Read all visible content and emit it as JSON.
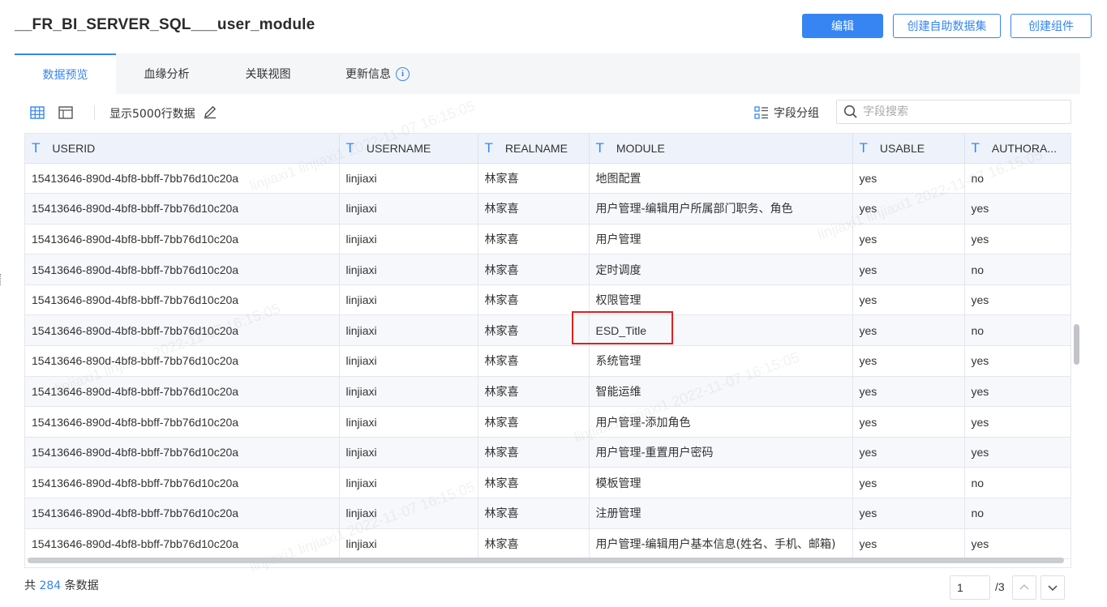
{
  "header": {
    "title": "__FR_BI_SERVER_SQL___user_module",
    "edit_label": "编辑",
    "create_dataset_label": "创建自助数据集",
    "create_component_label": "创建组件"
  },
  "tabs": [
    {
      "label": "数据预览",
      "active": true
    },
    {
      "label": "血缘分析",
      "active": false
    },
    {
      "label": "关联视图",
      "active": false
    },
    {
      "label": "更新信息",
      "active": false
    }
  ],
  "toolbar": {
    "rows_label": "显示5000行数据",
    "group_label": "字段分组",
    "search_placeholder": "字段搜索"
  },
  "table": {
    "type_icon": "T",
    "columns": [
      "USERID",
      "USERNAME",
      "REALNAME",
      "MODULE",
      "USABLE",
      "AUTHORA..."
    ],
    "rows": [
      [
        "15413646-890d-4bf8-bbff-7bb76d10c20a",
        "linjiaxi",
        "林家喜",
        "地图配置",
        "yes",
        "no"
      ],
      [
        "15413646-890d-4bf8-bbff-7bb76d10c20a",
        "linjiaxi",
        "林家喜",
        "用户管理-编辑用户所属部门职务、角色",
        "yes",
        "yes"
      ],
      [
        "15413646-890d-4bf8-bbff-7bb76d10c20a",
        "linjiaxi",
        "林家喜",
        "用户管理",
        "yes",
        "yes"
      ],
      [
        "15413646-890d-4bf8-bbff-7bb76d10c20a",
        "linjiaxi",
        "林家喜",
        "定时调度",
        "yes",
        "no"
      ],
      [
        "15413646-890d-4bf8-bbff-7bb76d10c20a",
        "linjiaxi",
        "林家喜",
        "权限管理",
        "yes",
        "yes"
      ],
      [
        "15413646-890d-4bf8-bbff-7bb76d10c20a",
        "linjiaxi",
        "林家喜",
        "ESD_Title",
        "yes",
        "no"
      ],
      [
        "15413646-890d-4bf8-bbff-7bb76d10c20a",
        "linjiaxi",
        "林家喜",
        "系统管理",
        "yes",
        "yes"
      ],
      [
        "15413646-890d-4bf8-bbff-7bb76d10c20a",
        "linjiaxi",
        "林家喜",
        "智能运维",
        "yes",
        "yes"
      ],
      [
        "15413646-890d-4bf8-bbff-7bb76d10c20a",
        "linjiaxi",
        "林家喜",
        "用户管理-添加角色",
        "yes",
        "yes"
      ],
      [
        "15413646-890d-4bf8-bbff-7bb76d10c20a",
        "linjiaxi",
        "林家喜",
        "用户管理-重置用户密码",
        "yes",
        "yes"
      ],
      [
        "15413646-890d-4bf8-bbff-7bb76d10c20a",
        "linjiaxi",
        "林家喜",
        "模板管理",
        "yes",
        "no"
      ],
      [
        "15413646-890d-4bf8-bbff-7bb76d10c20a",
        "linjiaxi",
        "林家喜",
        "注册管理",
        "yes",
        "no"
      ],
      [
        "15413646-890d-4bf8-bbff-7bb76d10c20a",
        "linjiaxi",
        "林家喜",
        "用户管理-编辑用户基本信息(姓名、手机、邮箱)",
        "yes",
        "yes"
      ]
    ]
  },
  "footer": {
    "total_prefix": "共",
    "total_count": "284",
    "total_suffix": "条数据",
    "page_value": "1",
    "page_total": "/3"
  },
  "watermark_text": "linjiaxi1  linjiaxi1  2022-11-07 16:15:05",
  "colors": {
    "accent": "#3685f2",
    "header_bg": "#eef3fb",
    "highlight": "#e02020"
  }
}
